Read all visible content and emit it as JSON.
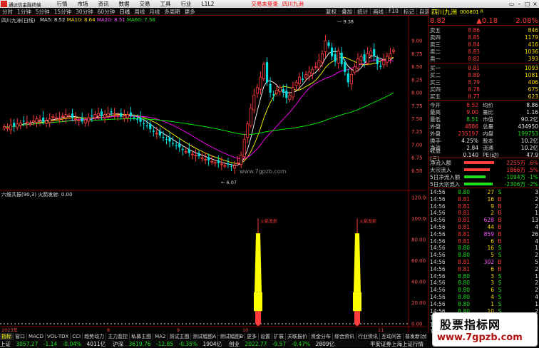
{
  "menubar": {
    "app_title": "通达信金融终端",
    "items": [
      "行情",
      "市场",
      "资讯",
      "数据",
      "交易",
      "工具",
      "行业",
      "L1L2"
    ],
    "alert": "交易未登录",
    "stock": "四川九洲"
  },
  "toolbar": {
    "periods": [
      "分时",
      "1分钟",
      "5分钟",
      "15分钟",
      "30分钟",
      "60分钟",
      "日线",
      "周线",
      "月线",
      "多周期",
      "更多"
    ],
    "active": "日线",
    "right_items": [
      "复权",
      "叠加",
      "统计",
      "画线",
      "F10",
      "标记",
      "自选",
      "返回"
    ],
    "stock_title": "四川九洲",
    "stock_code": "000801",
    "stock_suffix": "R"
  },
  "chart": {
    "title": "四川九洲(日线)",
    "ma_line": [
      "MA5: 8.52",
      "MA10: 8.64",
      "MA20: 8.51",
      "MA60: 7.58"
    ],
    "price_ticks": [
      "9.00",
      "8.75",
      "8.50",
      "8.25",
      "8.00",
      "7.75",
      "7.50",
      "7.25",
      "7.00",
      "6.75",
      "6.50"
    ],
    "high_label": "9.38",
    "low_label": "6.07",
    "watermark": "www.7gpzb.com",
    "indicator_line": "六维共振(90,3)  火箭发射: 0.00",
    "rocket_label": "火箭发射",
    "ind_ticks": [
      "120.00",
      "100.00",
      "80.00",
      "60.00",
      "40.00",
      "20.00",
      "0.00"
    ],
    "xaxis": [
      "2023年",
      "8",
      "9",
      "10",
      "11"
    ]
  },
  "chart_data": [
    {
      "type": "candlestick",
      "title": "四川九洲(日线)",
      "ylim": [
        6.3,
        9.4
      ],
      "series": [
        {
          "name": "MA5",
          "color": "#ffffff",
          "values": [
            8.52
          ]
        },
        {
          "name": "MA10",
          "color": "#ffff00",
          "values": [
            8.64
          ]
        },
        {
          "name": "MA20",
          "color": "#ff00ff",
          "values": [
            8.51
          ]
        },
        {
          "name": "MA60",
          "color": "#00ff00",
          "values": [
            7.58
          ]
        }
      ],
      "high": 9.38,
      "low": 6.07
    },
    {
      "type": "bar",
      "title": "六维共振(90,3)",
      "ylim": [
        0,
        120
      ],
      "series": [
        {
          "name": "火箭发射",
          "values": [
            0.0
          ]
        }
      ]
    }
  ],
  "quote": {
    "price": "8.82",
    "change": "▲0.18",
    "pct": "2.08%",
    "asks": [
      {
        "l": "卖五",
        "p": "8.86",
        "v": "846"
      },
      {
        "l": "卖四",
        "p": "8.85",
        "v": "1179"
      },
      {
        "l": "卖三",
        "p": "8.84",
        "v": "416"
      },
      {
        "l": "卖二",
        "p": "8.83",
        "v": "1036"
      },
      {
        "l": "卖一",
        "p": "8.82",
        "v": "393"
      }
    ],
    "bids": [
      {
        "l": "买一",
        "p": "8.81",
        "v": "1093"
      },
      {
        "l": "买二",
        "p": "8.80",
        "v": "1081"
      },
      {
        "l": "买三",
        "p": "8.79",
        "v": "406"
      },
      {
        "l": "买四",
        "p": "8.78",
        "v": "675"
      },
      {
        "l": "买五",
        "p": "8.77",
        "v": "623"
      }
    ],
    "stats": [
      [
        "今开",
        "8.52",
        "均价",
        "8.86"
      ],
      [
        "最高",
        "9.00",
        "量比",
        "1.16"
      ],
      [
        "最低",
        "8.51",
        "市值",
        "90.2亿"
      ],
      [
        "外盘",
        "4886",
        "总量",
        "434950"
      ],
      [
        "外盘",
        "235197",
        "内盘",
        "199753"
      ],
      [
        "换手",
        "4.25%",
        "股本",
        "10.2亿"
      ],
      [
        "净资",
        "2.84",
        "流通",
        "10.2亿"
      ],
      [
        "收益(三)",
        "0.140",
        "PE(动)",
        "47.9"
      ]
    ],
    "flows": [
      {
        "l": "净流入额",
        "v": "2255万",
        "p": ".6%"
      },
      {
        "l": "大宗流入",
        "v": "1866万",
        "p": ".5%"
      },
      {
        "l": "5日净流入额",
        "v": "-1094万",
        "p": "-1%"
      },
      {
        "l": "5日大宗流入",
        "v": "-2306万",
        "p": "-2%"
      }
    ],
    "ticks": [
      [
        "14:56",
        "8.80",
        "27",
        "S",
        "3"
      ],
      [
        "14:56",
        "8.81",
        "16",
        "B",
        "2"
      ],
      [
        "14:56",
        "8.81",
        "9",
        "B",
        "2"
      ],
      [
        "14:56",
        "8.81",
        "2",
        "B",
        "1"
      ],
      [
        "14:56",
        "8.81",
        "628",
        "B",
        "13"
      ],
      [
        "14:56",
        "8.81",
        "44",
        "B",
        "4"
      ],
      [
        "14:56",
        "8.81",
        "859",
        "B",
        "26"
      ],
      [
        "14:56",
        "8.81",
        "6",
        "B",
        "4"
      ],
      [
        "14:56",
        "8.80",
        "16",
        "S",
        "1"
      ],
      [
        "14:56",
        "8.80",
        "5",
        "S",
        "2"
      ],
      [
        "14:56",
        "8.81",
        "302",
        "B",
        "5"
      ],
      [
        "14:56",
        "8.81",
        "6",
        "B",
        "2"
      ],
      [
        "14:56",
        "8.80",
        "3",
        "S",
        "1"
      ],
      [
        "14:56",
        "8.80",
        "3",
        "S",
        "2"
      ],
      [
        "14:56",
        "8.80",
        "6",
        "S",
        "2"
      ],
      [
        "14:56",
        "8.80",
        "4",
        "S",
        "4"
      ],
      [
        "14:56",
        "8.80",
        "1",
        "S",
        "1"
      ],
      [
        "14:56",
        "8.80",
        "10",
        "S",
        "2"
      ],
      [
        "14:56",
        "8.80",
        "3",
        "S",
        "1"
      ],
      [
        "14:56",
        "8.80",
        "4",
        "S",
        "1"
      ],
      [
        "14:56",
        "8.81",
        "2",
        "B",
        "1"
      ]
    ]
  },
  "tabs": [
    "指标",
    "窗口",
    "MACD",
    "VOL-TDX",
    "CCI",
    "趋势动力",
    "主力监控",
    "私募主图",
    "MA2",
    "测试主图",
    "测试幅图A",
    "测试幅图B",
    "更多",
    "设置"
  ],
  "tabs2": [
    "扩展",
    "关联报价",
    "资金分布",
    "综合资讯",
    "行业资讯",
    "互动问答",
    "普发新功能说明"
  ],
  "tabs_right": [
    "模板",
    "—"
  ],
  "ticker": [
    {
      "name": "上证",
      "val": "3057.27",
      "chg": "-1.14",
      "pct": "-0.04%",
      "amt": "4011亿"
    },
    {
      "name": "沪深",
      "val": "3619.76",
      "chg": "-12.85",
      "pct": "-0.35%",
      "amt": "1904亿"
    },
    {
      "name": "创业",
      "val": "2022.77",
      "chg": "-9.57",
      "pct": "-0.47%",
      "amt": "2809亿"
    }
  ],
  "statusbar": "平安证券上海上证行情",
  "watermark": {
    "line1": "股票指标网",
    "line2": "www.7gpzb.com"
  }
}
